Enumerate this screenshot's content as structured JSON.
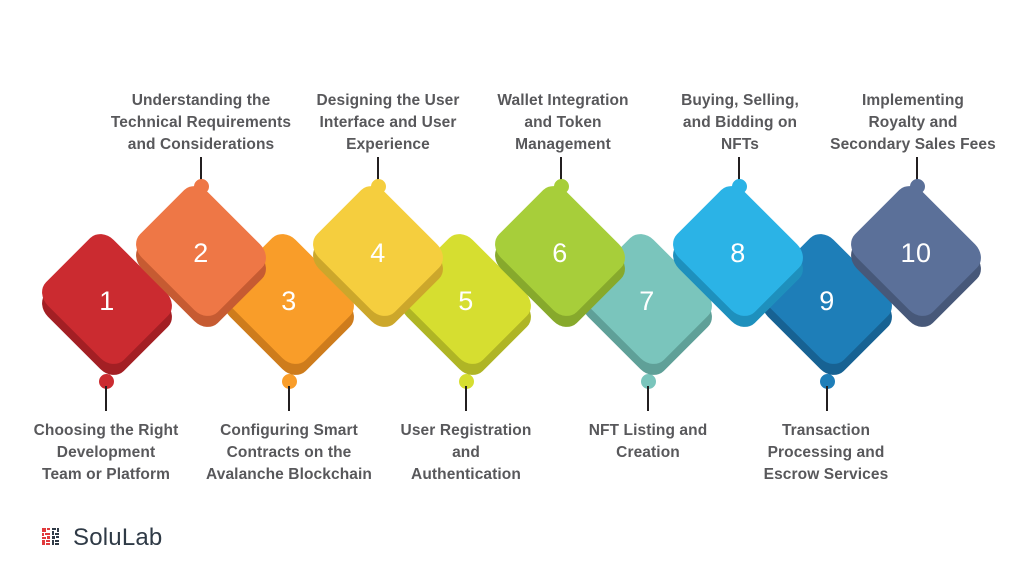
{
  "diagram": {
    "type": "process-flow-infographic",
    "step_count": 10,
    "steps": [
      {
        "number": "1",
        "label": "Choosing the Right\nDevelopment\nTeam or Platform",
        "position": "bottom",
        "color": "#CB2B30",
        "side_color": "#A31F24",
        "dot_color": "#CB2B30"
      },
      {
        "number": "2",
        "label": "Understanding the\nTechnical Requirements\nand Considerations",
        "position": "top",
        "color": "#EE7746",
        "side_color": "#C65B32",
        "dot_color": "#EE7746"
      },
      {
        "number": "3",
        "label": "Configuring Smart\nContracts on the\nAvalanche Blockchain",
        "position": "bottom",
        "color": "#F99D29",
        "side_color": "#CE7C1C",
        "dot_color": "#F99D29"
      },
      {
        "number": "4",
        "label": "Designing the User\nInterface and User\nExperience",
        "position": "top",
        "color": "#F5CE3E",
        "side_color": "#CCA72B",
        "dot_color": "#F5CE3E"
      },
      {
        "number": "5",
        "label": "User Registration\nand\nAuthentication",
        "position": "bottom",
        "color": "#D6DE30",
        "side_color": "#AFB525",
        "dot_color": "#D6DE30"
      },
      {
        "number": "6",
        "label": "Wallet Integration\nand Token\nManagement",
        "position": "top",
        "color": "#A7CE3A",
        "side_color": "#87A92C",
        "dot_color": "#A7CE3A"
      },
      {
        "number": "7",
        "label": "NFT Listing and\nCreation",
        "position": "bottom",
        "color": "#7AC5BC",
        "side_color": "#5FA098",
        "dot_color": "#7AC5BC"
      },
      {
        "number": "8",
        "label": "Buying, Selling,\nand Bidding on\nNFTs",
        "position": "top",
        "color": "#2BB3E6",
        "side_color": "#1E90BD",
        "dot_color": "#2BB3E6"
      },
      {
        "number": "9",
        "label": "Transaction\nProcessing and\nEscrow Services",
        "position": "bottom",
        "color": "#1E7EB8",
        "side_color": "#176293",
        "dot_color": "#1E7EB8"
      },
      {
        "number": "10",
        "label": "Implementing\nRoyalty and\nSecondary Sales Fees",
        "position": "top",
        "color": "#5B7099",
        "side_color": "#475879",
        "dot_color": "#5B7099"
      }
    ]
  },
  "branding": {
    "logo_text": "SoluLab",
    "logo_mark_name": "solulab-pixel-mark",
    "logo_mark_color": "#E03A3C",
    "logo_mark_dark": "#2F3A46",
    "logo_text_color": "#2F3A46"
  },
  "canvas": {
    "background": "#FFFFFF",
    "label_color": "#58585B",
    "stem_color": "#231F20"
  }
}
